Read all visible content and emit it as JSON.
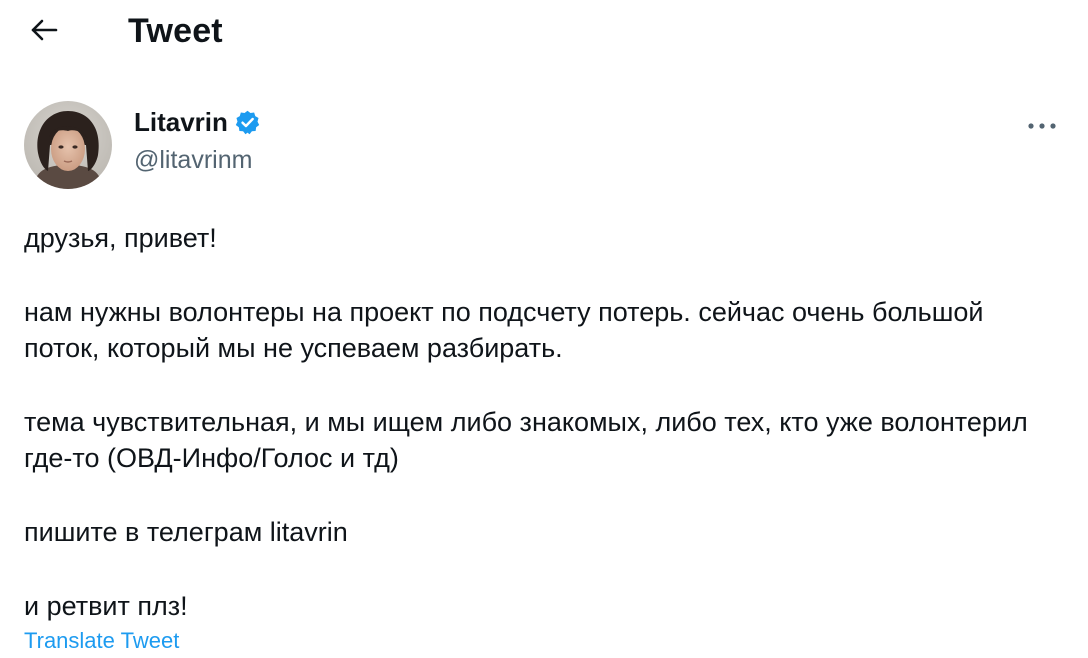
{
  "header": {
    "back_icon": "arrow-left-icon",
    "title": "Tweet"
  },
  "author": {
    "display_name": "Litavrin",
    "verified_icon": "verified-badge-icon",
    "verified_color": "#1d9bf0",
    "handle": "@litavrinm"
  },
  "more_icon": "more-horizontal-icon",
  "tweet": {
    "paragraphs": [
      "друзья, привет!",
      "нам нужны волонтеры на проект по подсчету потерь. сейчас очень большой поток, который мы не успеваем разбирать.",
      "тема чувствительная, и мы ищем либо знакомых, либо тех, кто уже волонтерил где-то (ОВД-Инфо/Голос и тд)",
      "пишите в телеграм litavrin",
      "и ретвит плз!"
    ],
    "translate_label": "Translate Tweet"
  },
  "colors": {
    "text": "#0f1419",
    "secondary": "#536471",
    "accent": "#1d9bf0"
  }
}
